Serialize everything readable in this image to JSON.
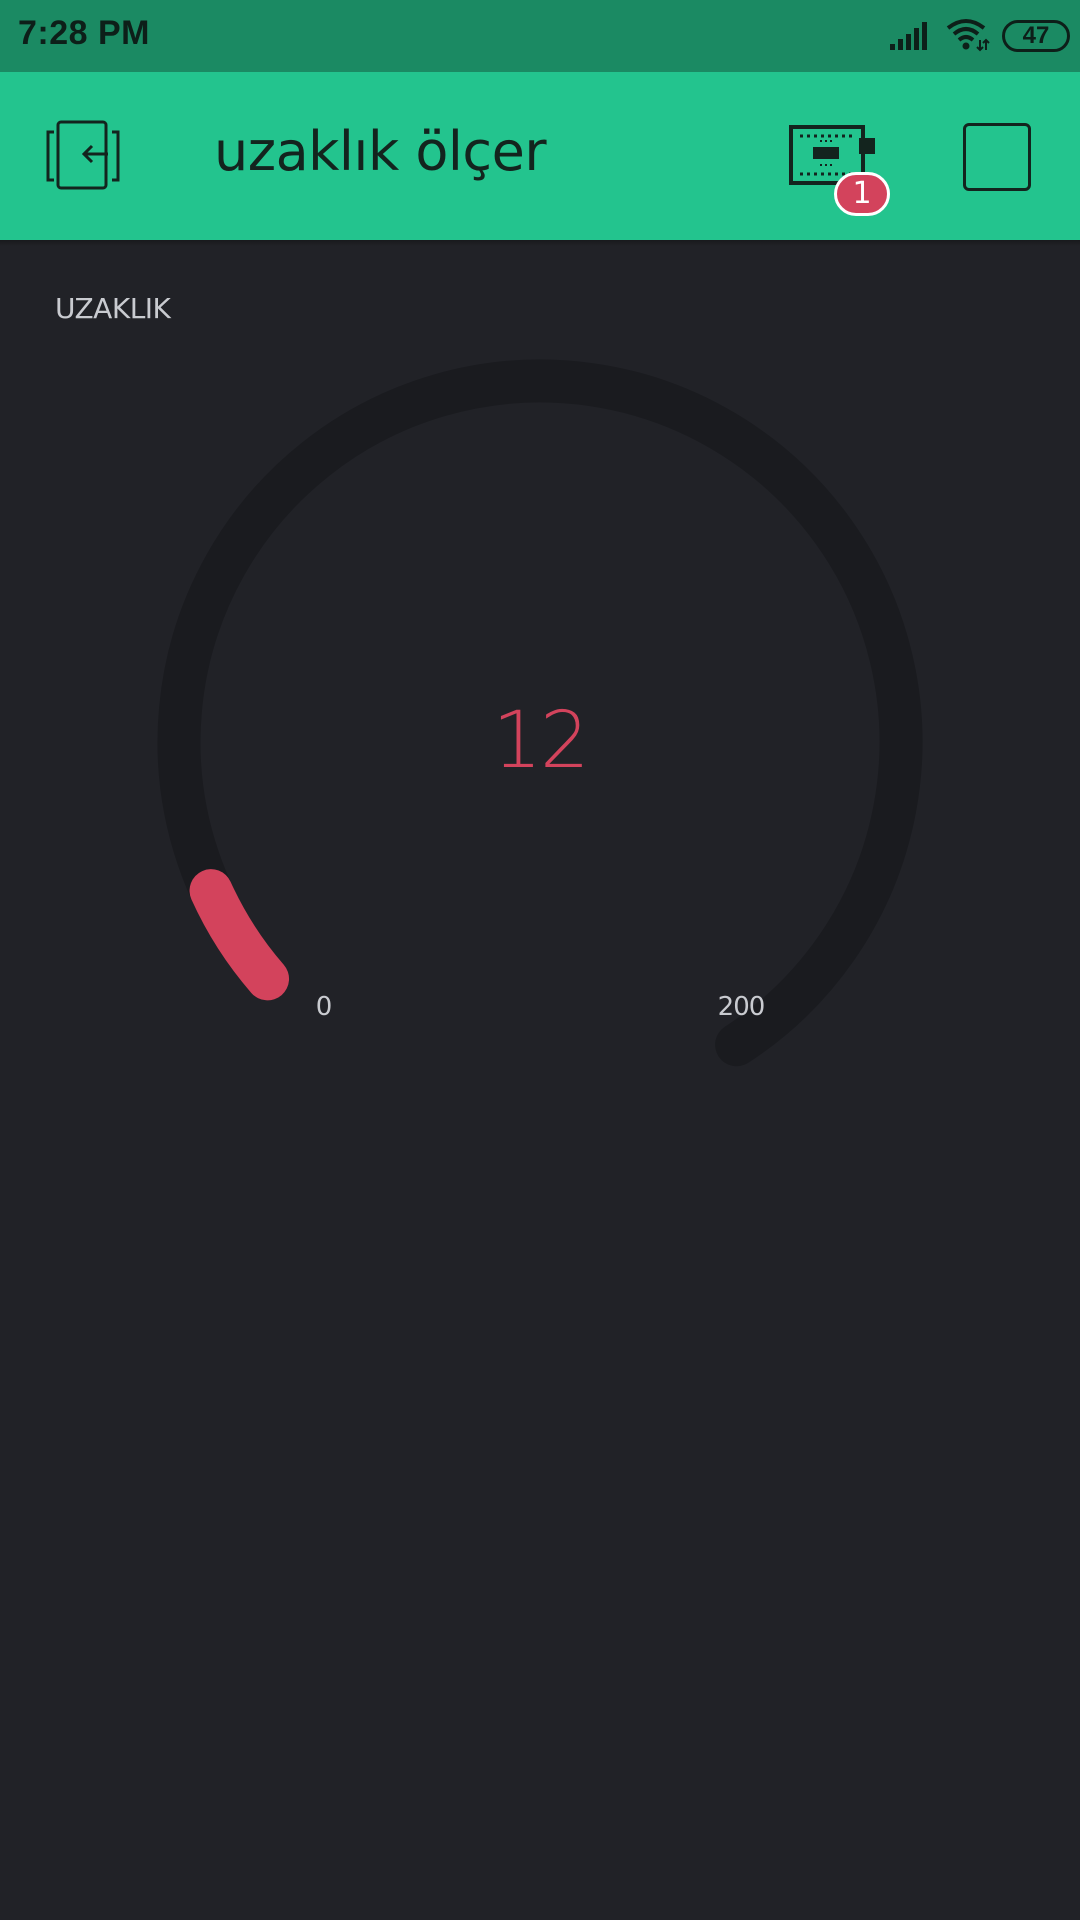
{
  "status_bar": {
    "time": "7:28 PM",
    "battery": "47",
    "icons": [
      "signal-icon",
      "wifi-icon",
      "battery-icon"
    ]
  },
  "app_bar": {
    "title": "uzaklık ölçer",
    "notification_count": "1",
    "icons": [
      "exit-icon",
      "device-icon",
      "stop-icon"
    ],
    "color": "#23c48e"
  },
  "gauge": {
    "label": "UZAKLIK",
    "value": "12",
    "value_number": 12,
    "min": "0",
    "max": "200",
    "min_number": 0,
    "max_number": 200,
    "accent_color": "#d3435c",
    "track_color": "#1a1b1f"
  }
}
